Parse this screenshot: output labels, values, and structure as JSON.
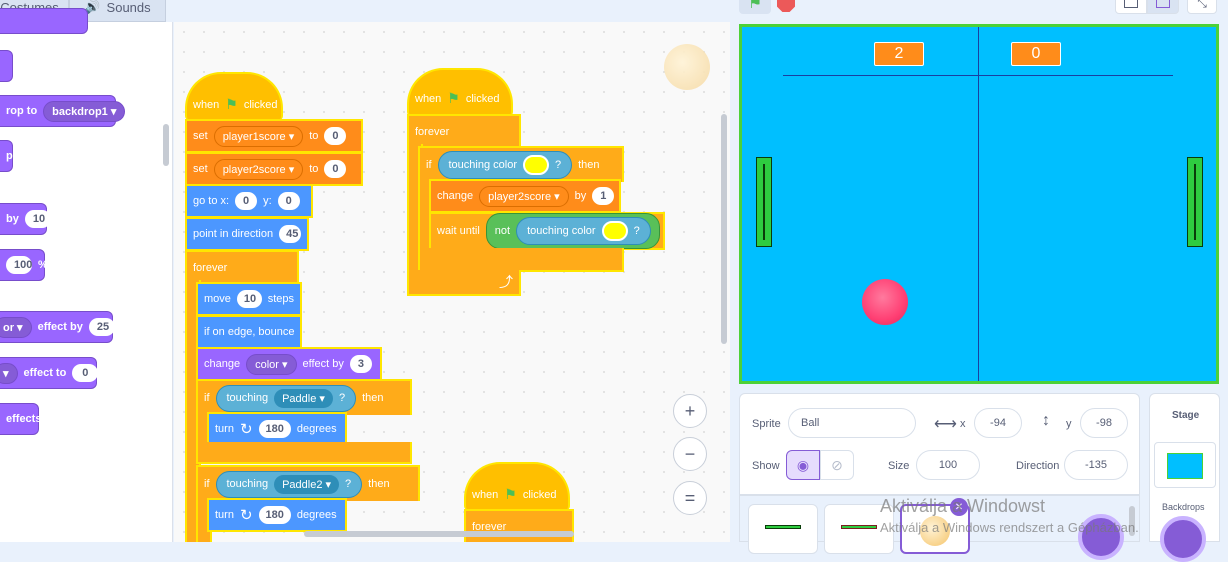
{
  "tabs": {
    "costumes": "Costumes",
    "sounds": "Sounds"
  },
  "palette": {
    "blocks": [
      {
        "pre": "rop to",
        "dd": "backdrop1 ▾"
      },
      {
        "pre": "p"
      },
      {
        "pre": "by",
        "val": "10"
      },
      {
        "val": "100",
        "post": "%"
      },
      {
        "dd": "or ▾",
        "pre": "effect by",
        "val": "25"
      },
      {
        "dd": "▾",
        "pre": "effect to",
        "val": "0"
      },
      {
        "pre": "effects"
      }
    ]
  },
  "script1": {
    "hat_when": "when",
    "hat_clicked": "clicked",
    "set1": {
      "label": "set",
      "var": "player1score ▾",
      "to": "to",
      "val": "0"
    },
    "set2": {
      "label": "set",
      "var": "player2score ▾",
      "to": "to",
      "val": "0"
    },
    "goto": {
      "label": "go to x:",
      "x": "0",
      "ylabel": "y:",
      "y": "0"
    },
    "point": {
      "label": "point in direction",
      "val": "45"
    },
    "forever": "forever",
    "move": {
      "label": "move",
      "val": "10",
      "post": "steps"
    },
    "bounce": "if on edge, bounce",
    "change": {
      "label": "change",
      "dd": "color ▾",
      "post": "effect by",
      "val": "3"
    },
    "if1": {
      "label": "if",
      "touching": "touching",
      "dd": "Paddle ▾",
      "q": "?",
      "then": "then"
    },
    "turn1": {
      "label": "turn",
      "icon": "↻",
      "val": "180",
      "post": "degrees"
    },
    "if2": {
      "label": "if",
      "touching": "touching",
      "dd": "Paddle2 ▾",
      "q": "?",
      "then": "then"
    },
    "turn2": {
      "label": "turn",
      "icon": "↻",
      "val": "180",
      "post": "degrees"
    }
  },
  "script2": {
    "hat_when": "when",
    "hat_clicked": "clicked",
    "forever": "forever",
    "if": {
      "label": "if",
      "touching": "touching color",
      "q": "?",
      "then": "then"
    },
    "change": {
      "label": "change",
      "var": "player2score ▾",
      "by": "by",
      "val": "1"
    },
    "wait": {
      "label": "wait until",
      "not": "not",
      "touching": "touching color",
      "q": "?"
    },
    "loop_arrow": "⤴"
  },
  "script3": {
    "hat_when": "when",
    "hat_clicked": "clicked",
    "forever": "forever"
  },
  "zoom": {
    "in": "+",
    "out": "−",
    "reset": "="
  },
  "stage": {
    "score_left": "2",
    "score_right": "0",
    "colors": {
      "background": "#00bfff",
      "score": "#ff8c1a",
      "paddle": "#2ecc40",
      "ball": "#ff3f73"
    }
  },
  "sprite_info": {
    "sprite_label": "Sprite",
    "sprite_name": "Ball",
    "x_label": "x",
    "x_value": "-94",
    "y_label": "y",
    "y_value": "-98",
    "show_label": "Show",
    "size_label": "Size",
    "size_value": "100",
    "direction_label": "Direction",
    "direction_value": "-135"
  },
  "stage_pane": {
    "title": "Stage",
    "backdrops": "Backdrops"
  },
  "watermark": {
    "line1": "Aktiválja a Windowst",
    "line2": "Aktiválja a Windows rendszert a Gépházban."
  }
}
